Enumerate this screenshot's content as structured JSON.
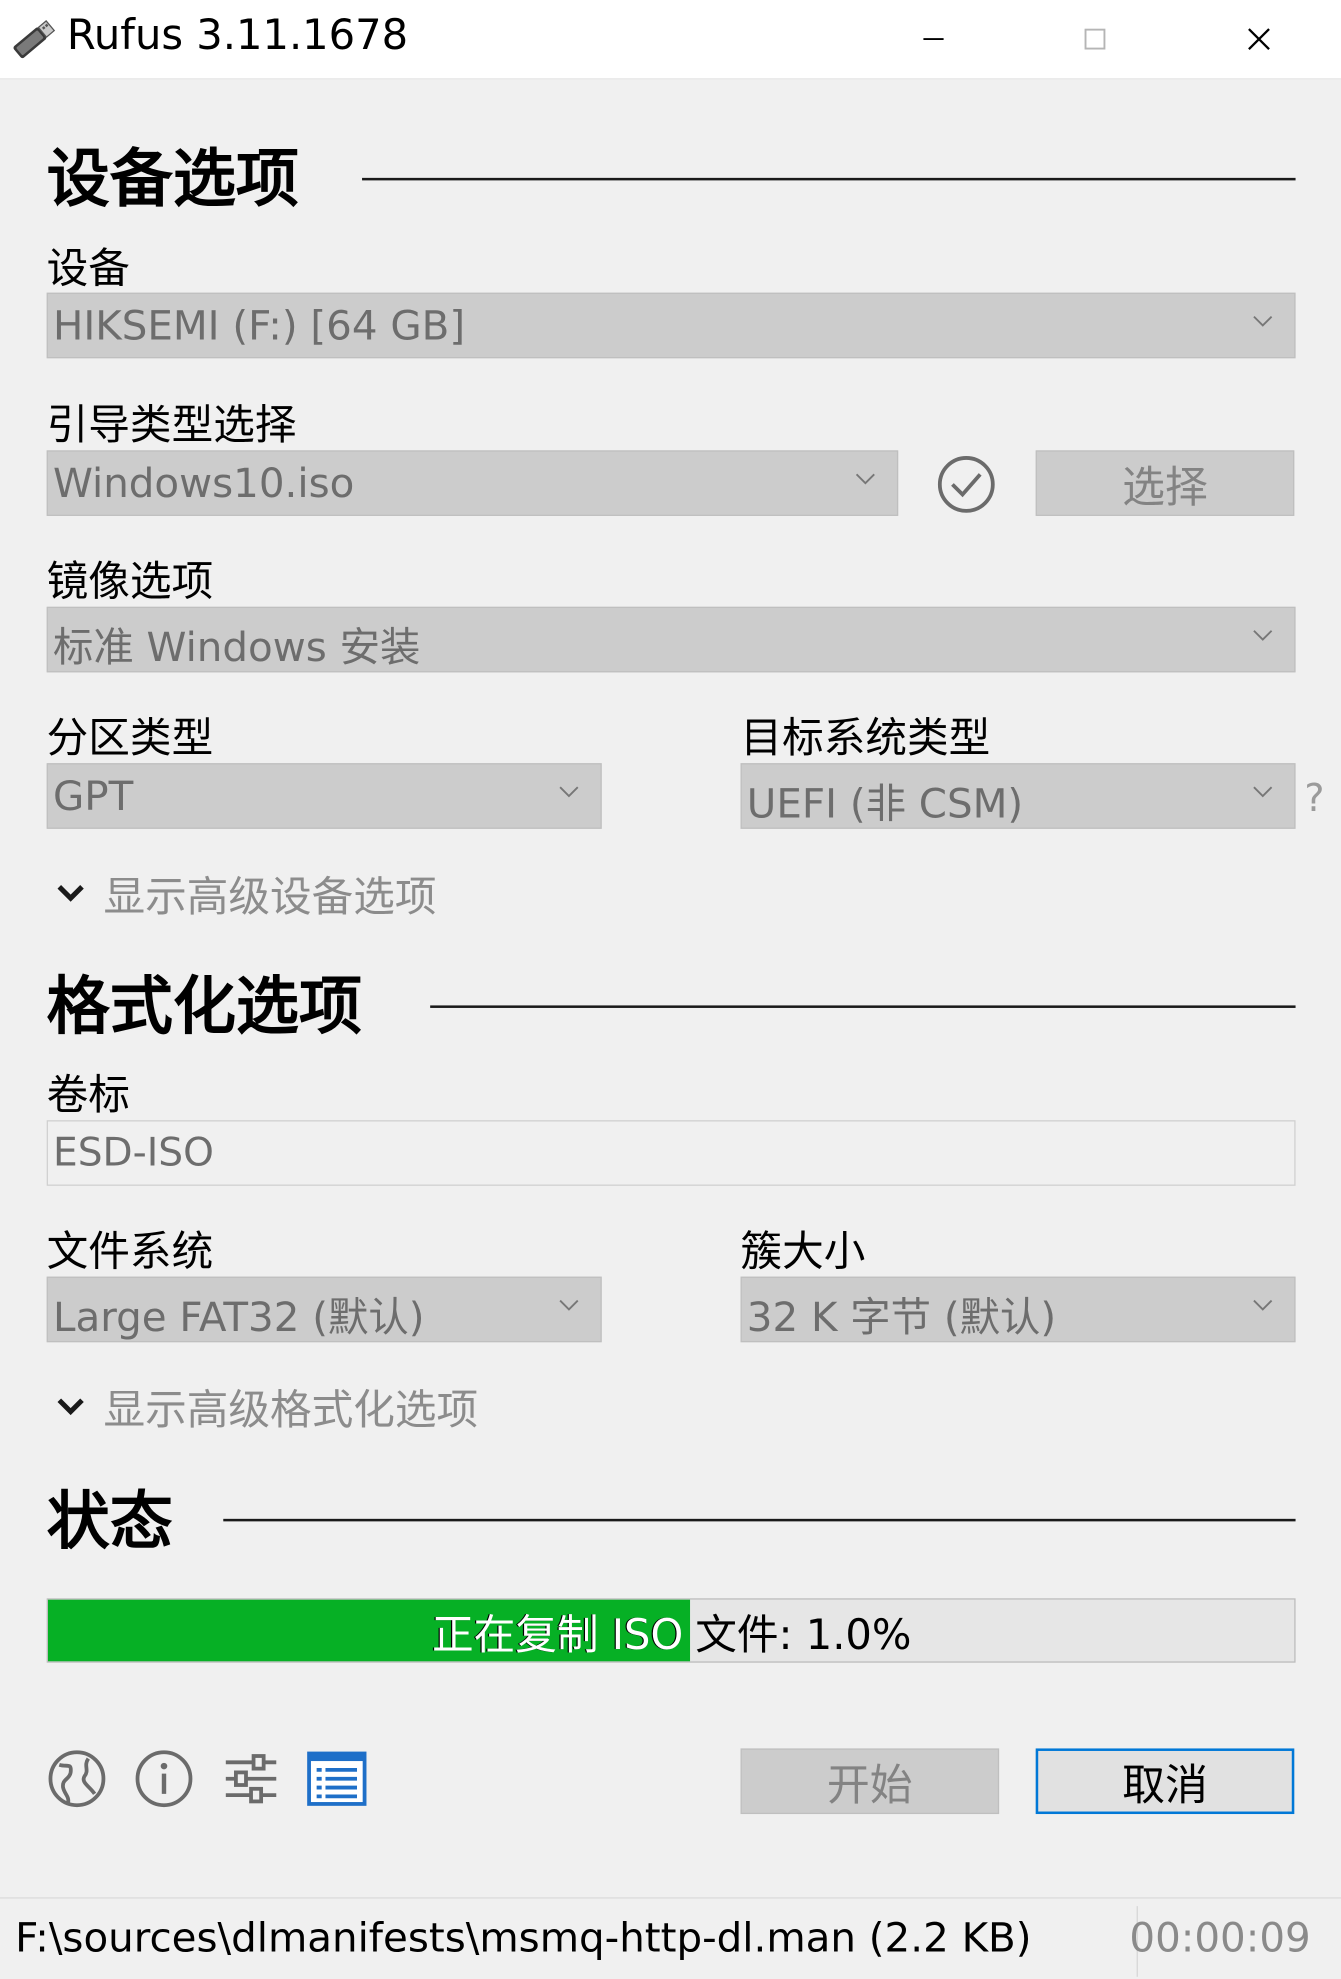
{
  "window": {
    "title": "Rufus 3.11.1678",
    "app_icon": "usb-drive-icon",
    "controls": [
      "minimize-icon",
      "maximize-icon",
      "close-icon"
    ]
  },
  "device_section": {
    "title": "设备选项",
    "device_label": "设备",
    "device_value": "HIKSEMI (F:) [64 GB]",
    "boot_label": "引导类型选择",
    "boot_value": "Windows10.iso",
    "verify_icon": "check-circle-icon",
    "select_button": "选择",
    "image_option_label": "镜像选项",
    "image_option_value": "标准 Windows 安装",
    "partition_label": "分区类型",
    "partition_value": "GPT",
    "target_label": "目标系统类型",
    "target_value": "UEFI (非 CSM)",
    "help": "?",
    "advanced_toggle": "显示高级设备选项"
  },
  "format_section": {
    "title": "格式化选项",
    "volume_label": "卷标",
    "volume_value": "ESD-ISO",
    "fs_label": "文件系统",
    "fs_value": "Large FAT32 (默认)",
    "cluster_label": "簇大小",
    "cluster_value": "32 K 字节 (默认)",
    "advanced_toggle": "显示高级格式化选项"
  },
  "status_section": {
    "title": "状态",
    "progress_text": "正在复制 ISO 文件: 1.0%",
    "progress_fill_fraction": 0.515,
    "progress_color": "#06b025"
  },
  "toolbar": {
    "icons": [
      "globe-icon",
      "info-icon",
      "settings-sliders-icon",
      "log-icon"
    ],
    "start_button": "开始",
    "cancel_button": "取消"
  },
  "statusbar": {
    "path": "F:\\sources\\dlmanifests\\msmq-http-dl.man (2.2 KB)",
    "elapsed": "00:00:09"
  }
}
